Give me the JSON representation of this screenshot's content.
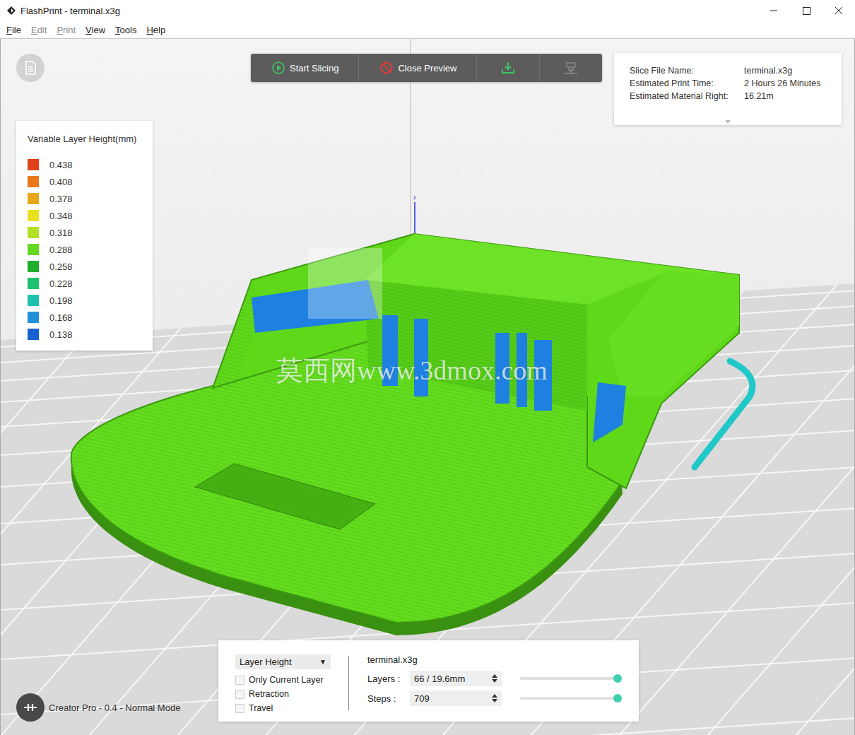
{
  "window": {
    "title": "FlashPrint - terminal.x3g"
  },
  "menu": [
    {
      "label": "File",
      "disabled": false
    },
    {
      "label": "Edit",
      "disabled": true
    },
    {
      "label": "Print",
      "disabled": true
    },
    {
      "label": "View",
      "disabled": false
    },
    {
      "label": "Tools",
      "disabled": false
    },
    {
      "label": "Help",
      "disabled": false
    }
  ],
  "toolbar": {
    "start": {
      "label": "Start Slicing",
      "disabled": false
    },
    "close": {
      "label": "Close Preview",
      "disabled": false
    },
    "export": {
      "disabled": false
    },
    "send": {
      "disabled": true
    }
  },
  "slice_info": {
    "rows": [
      {
        "label": "Slice File Name:",
        "value": "terminal.x3g"
      },
      {
        "label": "Estimated Print Time:",
        "value": "2 Hours 26 Minutes"
      },
      {
        "label": "Estimated Material Right:",
        "value": "16.21m"
      }
    ]
  },
  "legend": {
    "title": "Variable Layer Height(mm)",
    "items": [
      {
        "value": "0.438",
        "color": "#e0401a"
      },
      {
        "value": "0.408",
        "color": "#e8781a"
      },
      {
        "value": "0.378",
        "color": "#e6a818"
      },
      {
        "value": "0.348",
        "color": "#e8e020"
      },
      {
        "value": "0.318",
        "color": "#b2e024"
      },
      {
        "value": "0.288",
        "color": "#62d81e"
      },
      {
        "value": "0.258",
        "color": "#1fae2e"
      },
      {
        "value": "0.228",
        "color": "#20c070"
      },
      {
        "value": "0.198",
        "color": "#1fc0b0"
      },
      {
        "value": "0.168",
        "color": "#2090d8"
      },
      {
        "value": "0.138",
        "color": "#1860d0"
      }
    ]
  },
  "viewport": {
    "axis_label": "z",
    "watermark": "莫西网www.3dmox.com"
  },
  "preview_panel": {
    "mode": "Layer Height",
    "mode_arrow": "▼",
    "options": [
      {
        "label": "Only Current Layer",
        "checked": false
      },
      {
        "label": "Retraction",
        "checked": false
      },
      {
        "label": "Travel",
        "checked": false
      }
    ],
    "file": "terminal.x3g",
    "rows": [
      {
        "label": "Layers :",
        "value": "66 / 19.6mm",
        "level": 1
      },
      {
        "label": "Steps :",
        "value": "709",
        "level": 1
      }
    ]
  },
  "status": {
    "printer": "Creator Pro - 0.4 - Normal Mode"
  }
}
